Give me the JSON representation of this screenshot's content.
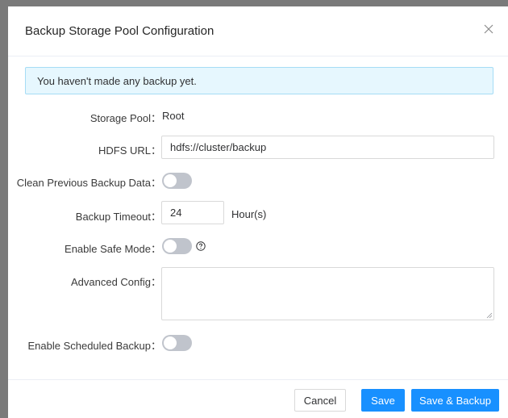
{
  "dialog": {
    "title": "Backup Storage Pool Configuration",
    "close_icon": "close-icon"
  },
  "alert": {
    "text": "You haven't made any backup yet."
  },
  "form": {
    "storage_pool": {
      "label": "Storage Pool：",
      "value": "Root"
    },
    "hdfs_url": {
      "label": "HDFS URL：",
      "value": "hdfs://cluster/backup"
    },
    "clean_previous": {
      "label": "Clean Previous Backup Data：",
      "checked": false
    },
    "backup_timeout": {
      "label": "Backup Timeout：",
      "value": "24",
      "unit": "Hour(s)"
    },
    "safe_mode": {
      "label": "Enable Safe Mode：",
      "checked": false,
      "help_icon": "question-circle-icon"
    },
    "advanced_config": {
      "label": "Advanced Config：",
      "value": ""
    },
    "scheduled_backup": {
      "label": "Enable Scheduled Backup：",
      "checked": false
    }
  },
  "footer": {
    "cancel_label": "Cancel",
    "save_label": "Save",
    "save_backup_label": "Save & Backup"
  },
  "colors": {
    "primary": "#1890ff",
    "alert_bg": "#e6f7fe",
    "alert_border": "#a6dcf5",
    "switch_off": "#c0c4cc"
  }
}
